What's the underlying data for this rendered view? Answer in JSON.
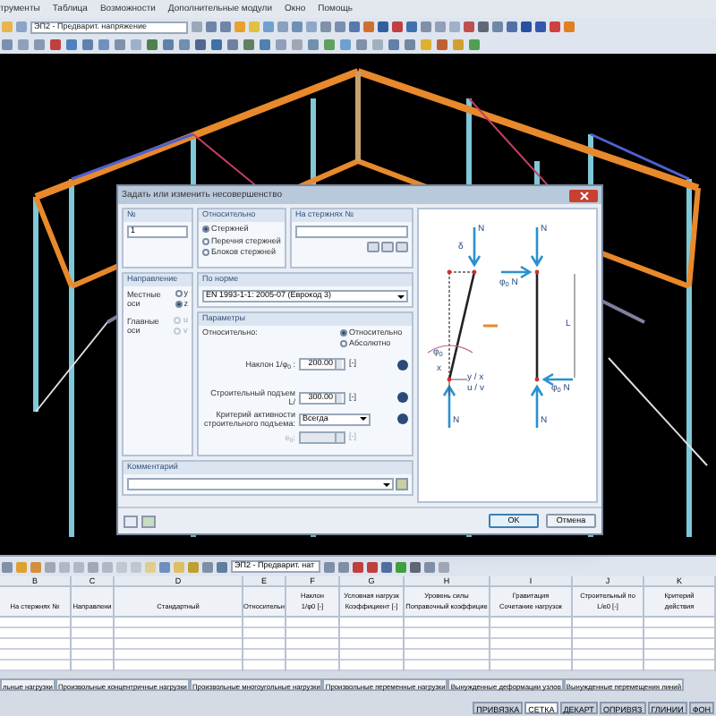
{
  "menu": [
    "трументы",
    "Таблица",
    "Возможности",
    "Дополнительные модули",
    "Окно",
    "Помощь"
  ],
  "toolbar": {
    "load_case": "ЭП2 - Предварит. напряжение"
  },
  "dialog": {
    "title": "Задать или изменить несовершенство",
    "number": {
      "label": "№",
      "value": "1"
    },
    "relative_to": {
      "label": "Относительно",
      "options": [
        {
          "label": "Стержней",
          "selected": true
        },
        {
          "label": "Перечня стержней",
          "selected": false
        },
        {
          "label": "Блоков стержней",
          "selected": false
        }
      ]
    },
    "on_members": {
      "label": "На стержнях №"
    },
    "direction": {
      "label": "Направление",
      "groups": [
        {
          "label": "Местные оси",
          "options": [
            {
              "label": "y",
              "selected": false,
              "disabled": false
            },
            {
              "label": "z",
              "selected": true,
              "disabled": false
            }
          ]
        },
        {
          "label": "Главные оси",
          "options": [
            {
              "label": "u",
              "selected": false,
              "disabled": true
            },
            {
              "label": "v",
              "selected": false,
              "disabled": true
            }
          ]
        }
      ]
    },
    "code": {
      "label": "По норме",
      "value": "EN 1993-1-1: 2005-07 (Еврокод 3)"
    },
    "parameters": {
      "label": "Параметры",
      "relative_label": "Относительно:",
      "options": [
        {
          "label": "Относительно",
          "selected": true
        },
        {
          "label": "Абсолютно",
          "selected": false
        }
      ],
      "fields": [
        {
          "kind": "spin",
          "label": "Наклон 1/φ$_{0}$ :",
          "value": "200.00",
          "unit": "[-]",
          "disabled": false
        },
        {
          "kind": "spin",
          "label": "Строительный подъем L/",
          "value": "300.00",
          "unit": "[-]",
          "disabled": false
        },
        {
          "kind": "select",
          "label": "Критерий активности строительного подъема:",
          "value": "Всегда",
          "disabled": false
        },
        {
          "kind": "spin",
          "label": "e$_{0}$:",
          "unit": "[-]",
          "disabled": true
        }
      ]
    },
    "comment": {
      "label": "Комментарий"
    },
    "buttons": [
      {
        "label": "OK",
        "default": true
      },
      {
        "label": "Отмена",
        "default": false
      }
    ],
    "diagram": {
      "labels": [
        "δ",
        "N",
        "N",
        "φ$_{0}$ N",
        "L",
        "φ$_{0}$",
        "x",
        "y / x",
        "u / v",
        "N",
        "φ$_{0}$ N",
        "N"
      ]
    }
  },
  "table": {
    "load_case": "ЭП2 - Предварит. нат",
    "columns": [
      {
        "letter": "B",
        "lines": [
          "На стержнях №"
        ]
      },
      {
        "letter": "C",
        "lines": [
          "Направлени"
        ]
      },
      {
        "letter": "D",
        "lines": [
          "Стандартный"
        ]
      },
      {
        "letter": "E",
        "lines": [
          "Относительн"
        ]
      },
      {
        "letter": "F",
        "lines": [
          "Наклон",
          "1/φ0 [-]"
        ]
      },
      {
        "letter": "G",
        "lines": [
          "Условная нагрузк",
          "Коэффициент [-]"
        ]
      },
      {
        "letter": "H",
        "lines": [
          "Уровень силы",
          "Поправочный коэффицие"
        ]
      },
      {
        "letter": "I",
        "lines": [
          "Гравитация",
          "Сочетание нагрузок"
        ]
      },
      {
        "letter": "J",
        "lines": [
          "Строительный по",
          "L/e0 [-]"
        ]
      },
      {
        "letter": "K",
        "lines": [
          "Критерий",
          "действия"
        ]
      }
    ]
  },
  "sheet_tabs": [
    "льные нагрузки",
    "Произвольные концентричные нагрузки",
    "Произвольные многоугольные нагрузки",
    "Произвольные переменные нагрузки",
    "Вынужденные деформации узлов",
    "Вынужденные перемещения линий"
  ],
  "status_bar": [
    {
      "label": "ПРИВЯЗКА",
      "on": false
    },
    {
      "label": "СЕТКА",
      "on": true
    },
    {
      "label": "ДЕКАРТ",
      "on": false
    },
    {
      "label": "ОПРИВЯЗ",
      "on": false
    },
    {
      "label": "ГЛИНИИ",
      "on": false
    },
    {
      "label": "ФОН",
      "on": false
    }
  ]
}
